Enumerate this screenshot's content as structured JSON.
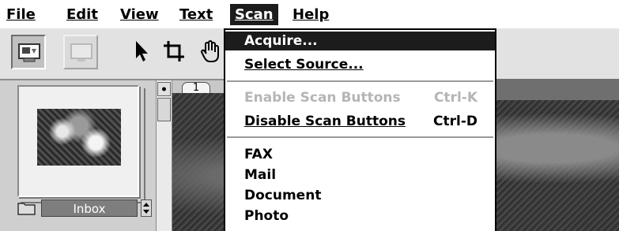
{
  "menubar": {
    "items": [
      {
        "label": "File"
      },
      {
        "label": "Edit"
      },
      {
        "label": "View"
      },
      {
        "label": "Text"
      },
      {
        "label": "Scan"
      },
      {
        "label": "Help"
      }
    ]
  },
  "toolbar": {
    "buttons": [
      {
        "icon": "scanner-desktop-icon"
      },
      {
        "icon": "monitor-disabled-icon"
      },
      {
        "icon": "arrow-pointer-icon"
      },
      {
        "icon": "crop-icon"
      },
      {
        "icon": "hand-icon"
      }
    ]
  },
  "left_panel": {
    "folder_name": "Inbox"
  },
  "tabs": {
    "page": "1"
  },
  "scan_menu": {
    "acquire": "Acquire...",
    "select_source": "Select Source...",
    "enable_scan_buttons": "Enable Scan Buttons",
    "enable_shortcut": "Ctrl-K",
    "disable_scan_buttons": "Disable Scan Buttons",
    "disable_shortcut": "Ctrl-D",
    "fax": "FAX",
    "mail": "Mail",
    "document": "Document",
    "photo": "Photo"
  },
  "colors": {
    "highlight": "#1c1c1c",
    "disabled_text": "#b5b5b5"
  }
}
